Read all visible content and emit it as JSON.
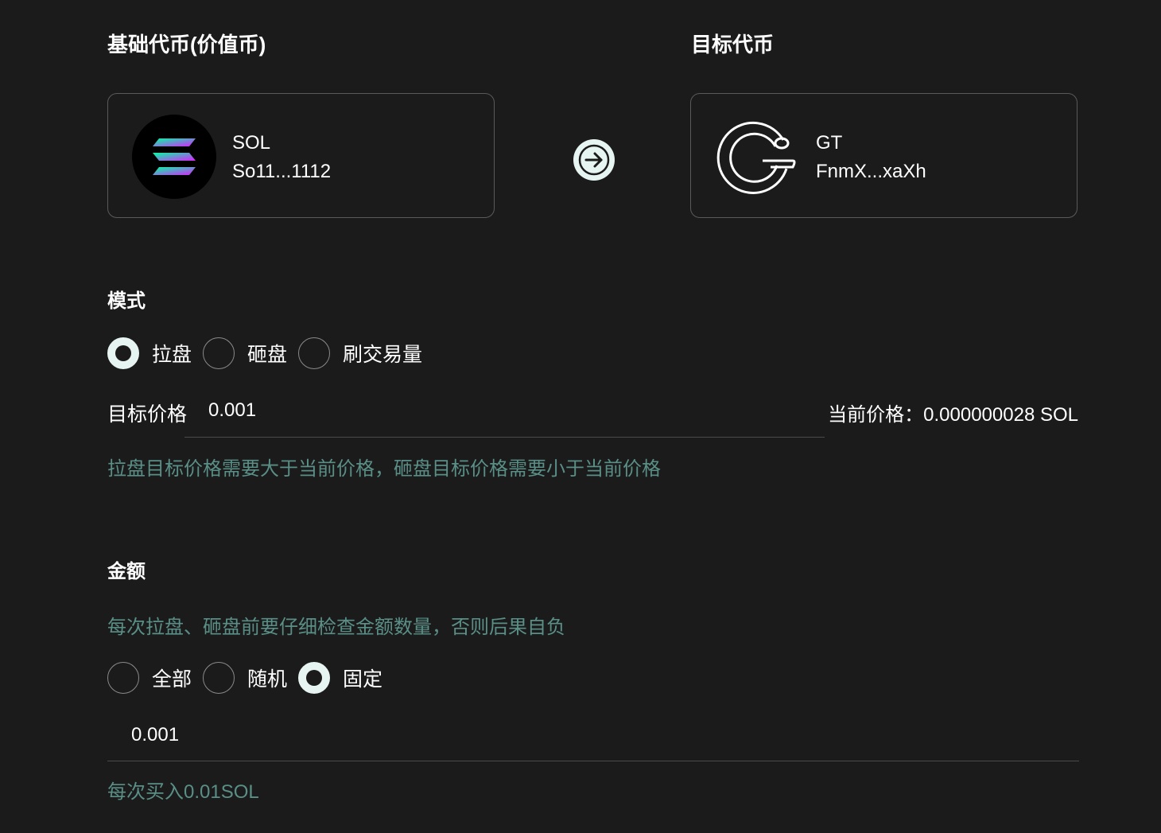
{
  "tokens": {
    "base_title": "基础代币(价值币)",
    "target_title": "目标代币",
    "base": {
      "symbol": "SOL",
      "address": "So11...1112",
      "logo_icon": "solana-logo-icon"
    },
    "target": {
      "symbol": "GT",
      "address": "FnmX...xaXh",
      "logo_icon": "gt-logo-icon"
    },
    "swap_icon": "arrow-right-icon"
  },
  "mode": {
    "title": "模式",
    "options": [
      {
        "label": "拉盘",
        "checked": true
      },
      {
        "label": "砸盘",
        "checked": false
      },
      {
        "label": "刷交易量",
        "checked": false
      }
    ],
    "target_price_label": "目标价格",
    "target_price_value": "0.001",
    "current_price_text": "当前价格：0.000000028 SOL",
    "hint": "拉盘目标价格需要大于当前价格，砸盘目标价格需要小于当前价格"
  },
  "amount": {
    "title": "金额",
    "warning": "每次拉盘、砸盘前要仔细检查金额数量，否则后果自负",
    "options": [
      {
        "label": "全部",
        "checked": false
      },
      {
        "label": "随机",
        "checked": false
      },
      {
        "label": "固定",
        "checked": true
      }
    ],
    "value": "0.001",
    "hint": "每次买入0.01SOL"
  },
  "colors": {
    "background": "#1b1b1b",
    "hint": "#5a8f87",
    "radio_checked": "#e6f4f2",
    "card_border": "#5a5a5a"
  }
}
